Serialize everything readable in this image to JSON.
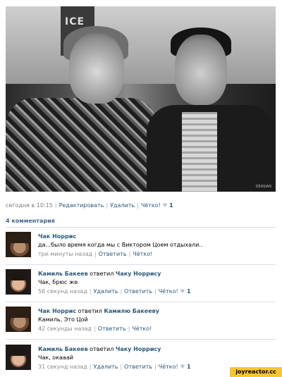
{
  "photo": {
    "sign_text": "ICE",
    "watermark": "DEASIAN"
  },
  "post_meta": {
    "time": "сегодня в 10:15",
    "edit": "Редактировать",
    "delete": "Удалить",
    "like_label": "Чётко!",
    "like_count": "1"
  },
  "comments_title": "4 комментария",
  "comments": [
    {
      "author": "Чак Норрис",
      "replied_text": "",
      "reply_to": "",
      "text": "да...было время когда мы с Виктором Цоем отдыхали..",
      "time": "три минуты назад",
      "reply": "Ответить",
      "delete": "",
      "like_label": "Чётко!",
      "like_count": ""
    },
    {
      "author": "Камиль Бакеев",
      "replied_text": "ответил",
      "reply_to": "Чаку Норрису",
      "text": "Чак, брюс же",
      "time": "56 секунд назад",
      "reply": "Ответить",
      "delete": "Удалить",
      "like_label": "Чётко!",
      "like_count": "1"
    },
    {
      "author": "Чак Норрис",
      "replied_text": "ответил",
      "reply_to": "Камилю Бакееву",
      "text": "Камиль, Это Цой",
      "time": "42 секунды назад",
      "reply": "Ответить",
      "delete": "",
      "like_label": "Чётко!",
      "like_count": ""
    },
    {
      "author": "Камиль Бакеев",
      "replied_text": "ответил",
      "reply_to": "Чаку Норрису",
      "text": "Чак, окааай",
      "time": "31 секунд назад",
      "reply": "Ответить",
      "delete": "Удалить",
      "like_label": "Чётко!",
      "like_count": "1"
    }
  ],
  "brand": "joyreactor.cc"
}
